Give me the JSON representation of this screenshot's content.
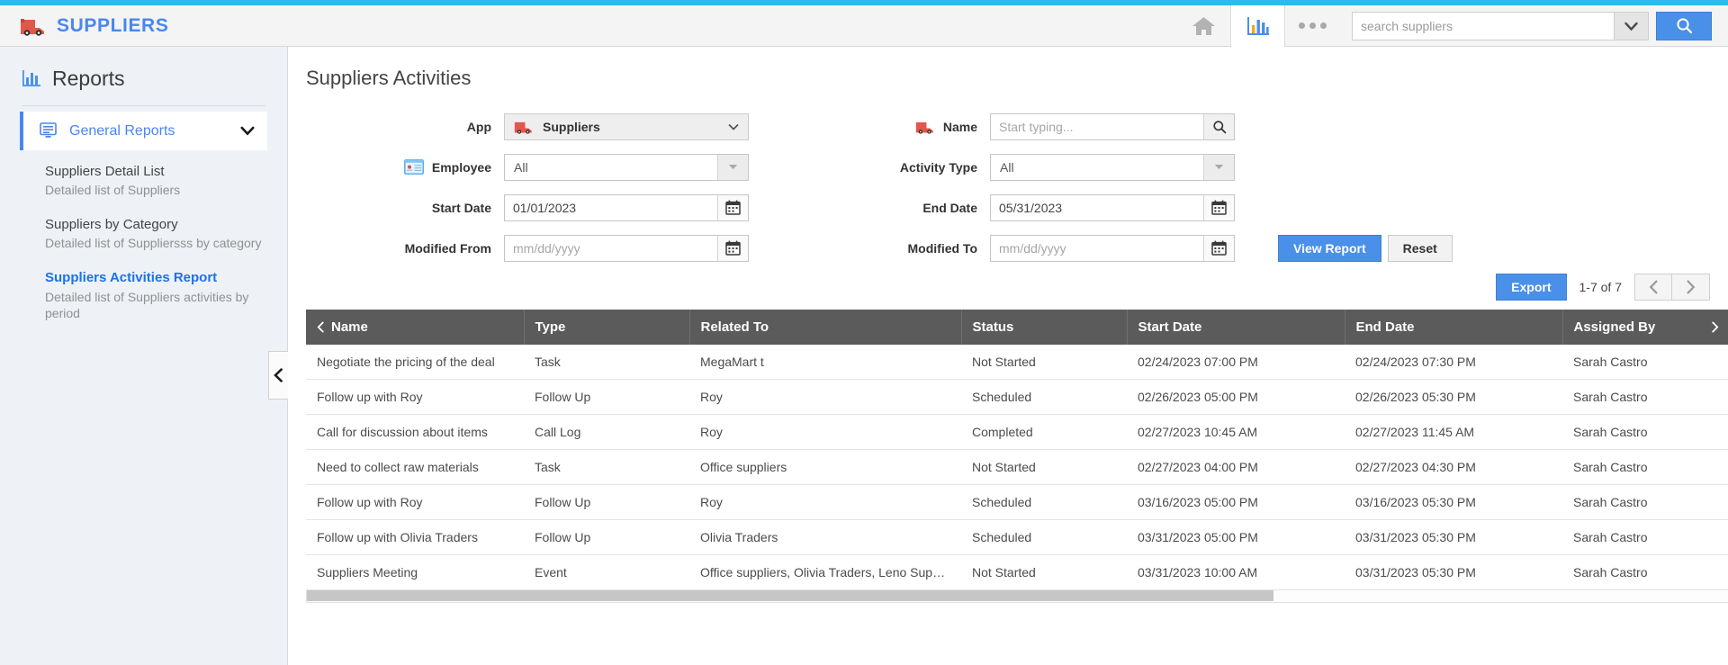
{
  "theme": {
    "accent": "#2fb9f0",
    "brand_blue": "#4a86ee",
    "primary_button": "#4a90e8",
    "header_row": "#5b5b5b",
    "logo_red": "#e2574c"
  },
  "topbar": {
    "brand_title": "SUPPLIERS",
    "logo_icon": "truck-icon",
    "home_icon": "home-icon",
    "reports_icon": "bar-chart-icon",
    "more_icon": "more-dots-icon",
    "search_placeholder": "search suppliers",
    "search_value": "",
    "search_caret_icon": "chevron-down-icon",
    "search_button_icon": "search-icon"
  },
  "sidebar": {
    "header": {
      "title": "Reports",
      "icon": "bar-chart-icon"
    },
    "group": {
      "label": "General Reports",
      "icon": "report-screen-icon",
      "chevron": "chevron-down-icon"
    },
    "items": [
      {
        "title": "Suppliers Detail List",
        "subtitle": "Detailed list of Suppliers",
        "selected": false
      },
      {
        "title": "Suppliers by Category",
        "subtitle": "Detailed list of Suppliersss by category",
        "selected": false
      },
      {
        "title": "Suppliers Activities Report",
        "subtitle": "Detailed list of Suppliers activities by period",
        "selected": true
      }
    ],
    "collapse_icon": "chevron-left-icon"
  },
  "main": {
    "page_title": "Suppliers Activities",
    "filters": {
      "app": {
        "label": "App",
        "value": "Suppliers",
        "icon": "truck-icon",
        "caret_icon": "caret-down-icon"
      },
      "employee": {
        "label": "Employee",
        "value": "All",
        "icon": "id-card-icon",
        "caret_icon": "caret-down-icon"
      },
      "start_date": {
        "label": "Start Date",
        "value": "01/01/2023",
        "placeholder": "mm/dd/yyyy",
        "icon": "calendar-icon"
      },
      "modified_from": {
        "label": "Modified From",
        "value": "",
        "placeholder": "mm/dd/yyyy",
        "icon": "calendar-icon"
      },
      "name": {
        "label": "Name",
        "value": "",
        "placeholder": "Start typing...",
        "icon": "truck-icon",
        "button_icon": "search-icon"
      },
      "activity_type": {
        "label": "Activity Type",
        "value": "All",
        "caret_icon": "caret-down-icon"
      },
      "end_date": {
        "label": "End Date",
        "value": "05/31/2023",
        "placeholder": "mm/dd/yyyy",
        "icon": "calendar-icon"
      },
      "modified_to": {
        "label": "Modified To",
        "value": "",
        "placeholder": "mm/dd/yyyy",
        "icon": "calendar-icon"
      }
    },
    "actions": {
      "view_report": "View Report",
      "reset": "Reset"
    },
    "toolbar": {
      "export": "Export",
      "pager_info": "1-7 of 7",
      "prev_icon": "chevron-left-icon",
      "next_icon": "chevron-right-icon"
    },
    "table": {
      "sort_icon": "chevron-left-icon",
      "expand_icon": "chevron-right-icon",
      "columns": [
        "Name",
        "Type",
        "Related To",
        "Status",
        "Start Date",
        "End Date",
        "Assigned By"
      ],
      "rows": [
        {
          "name": "Negotiate the pricing of the deal",
          "type": "Task",
          "related_to": "MegaMart t",
          "status": "Not Started",
          "start_date": "02/24/2023 07:00 PM",
          "end_date": "02/24/2023 07:30 PM",
          "assigned_by": "Sarah Castro"
        },
        {
          "name": "Follow up with Roy",
          "type": "Follow Up",
          "related_to": "Roy",
          "status": "Scheduled",
          "start_date": "02/26/2023 05:00 PM",
          "end_date": "02/26/2023 05:30 PM",
          "assigned_by": "Sarah Castro"
        },
        {
          "name": "Call for discussion about items",
          "type": "Call Log",
          "related_to": "Roy",
          "status": "Completed",
          "start_date": "02/27/2023 10:45 AM",
          "end_date": "02/27/2023 11:45 AM",
          "assigned_by": "Sarah Castro"
        },
        {
          "name": "Need to collect raw materials",
          "type": "Task",
          "related_to": "Office suppliers",
          "status": "Not Started",
          "start_date": "02/27/2023 04:00 PM",
          "end_date": "02/27/2023 04:30 PM",
          "assigned_by": "Sarah Castro"
        },
        {
          "name": "Follow up with Roy",
          "type": "Follow Up",
          "related_to": "Roy",
          "status": "Scheduled",
          "start_date": "03/16/2023 05:00 PM",
          "end_date": "03/16/2023 05:30 PM",
          "assigned_by": "Sarah Castro"
        },
        {
          "name": "Follow up with Olivia Traders",
          "type": "Follow Up",
          "related_to": "Olivia Traders",
          "status": "Scheduled",
          "start_date": "03/31/2023 05:00 PM",
          "end_date": "03/31/2023 05:30 PM",
          "assigned_by": "Sarah Castro"
        },
        {
          "name": "Suppliers Meeting",
          "type": "Event",
          "related_to": "Office suppliers, Olivia Traders, Leno Suppl...",
          "status": "Not Started",
          "start_date": "03/31/2023 10:00 AM",
          "end_date": "03/31/2023 05:30 PM",
          "assigned_by": "Sarah Castro"
        }
      ]
    }
  }
}
